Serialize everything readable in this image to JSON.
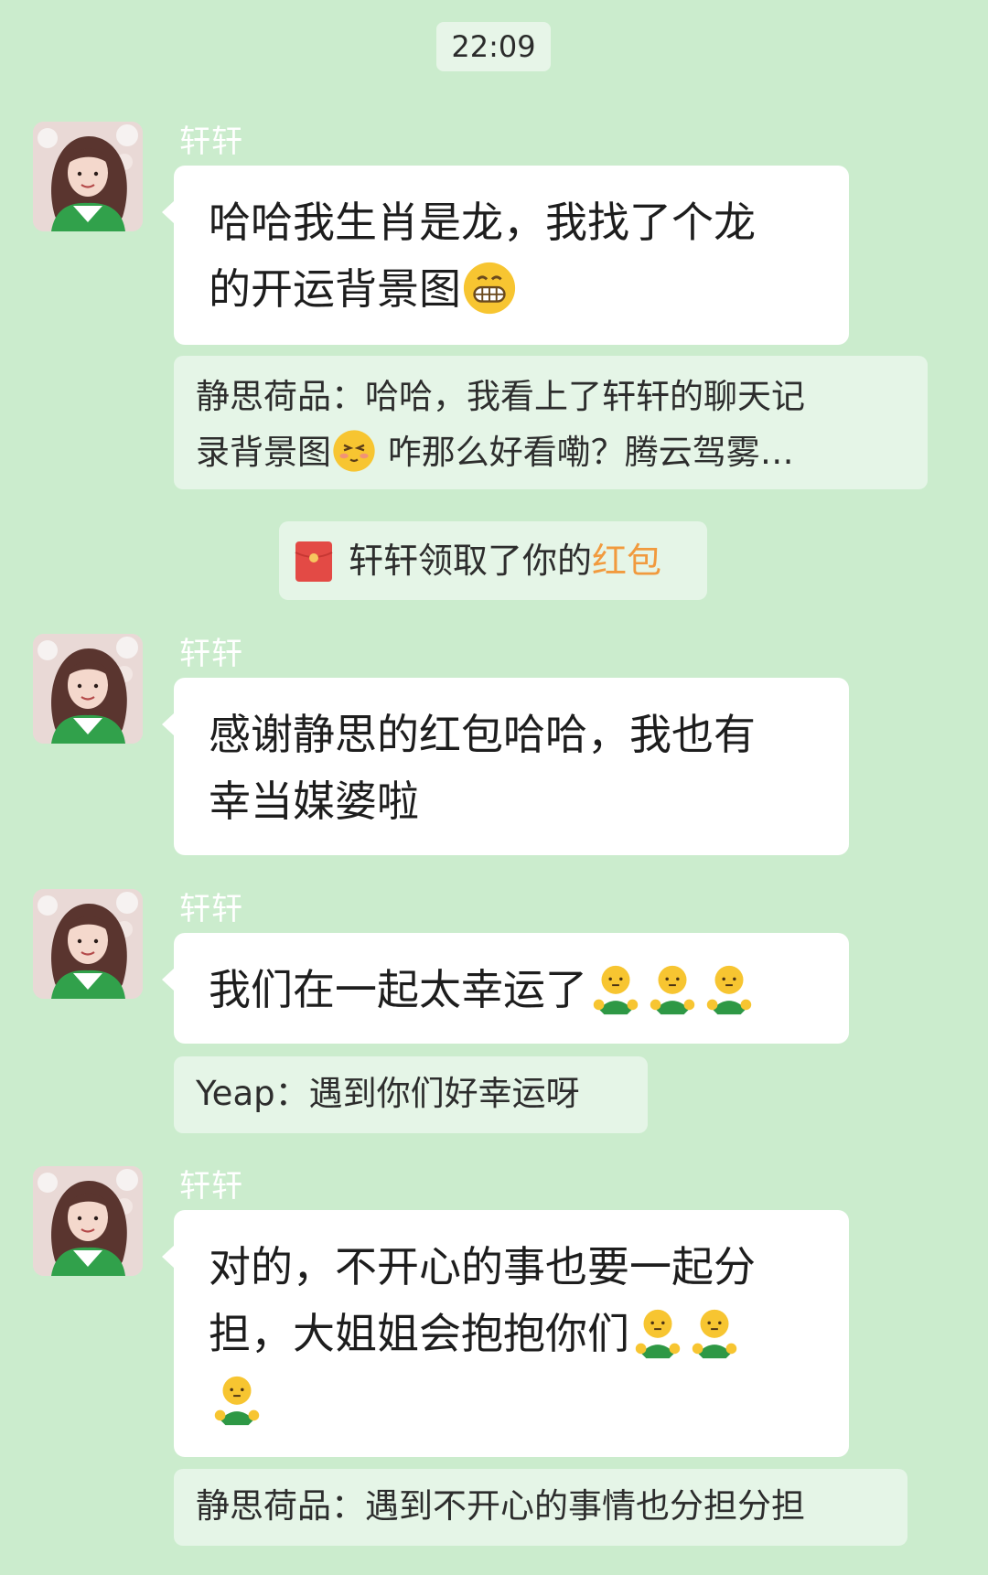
{
  "chat": {
    "timestamp": "22:09",
    "messages": [
      {
        "sender": "轩轩",
        "lines": [
          "哈哈我生肖是龙，我找了个龙",
          "的开运背景图"
        ],
        "trailing_emoji": "grin-emoji"
      },
      {
        "sender": "轩轩",
        "lines": [
          "感谢静思的红包哈哈，我也有",
          "幸当媒婆啦"
        ]
      },
      {
        "sender": "轩轩",
        "lines": [
          "我们在一起太幸运了"
        ],
        "trailing_emoji": "hug-emoji x3"
      },
      {
        "sender": "轩轩",
        "lines": [
          "对的，不开心的事也要一起分",
          "担，大姐姐会抱抱你们"
        ],
        "trailing_emoji": "hug-emoji x3"
      }
    ],
    "quotes": [
      {
        "line1": "静思荷品：哈哈，我看上了轩轩的聊天记",
        "line2_prefix": "录背景图",
        "line2_suffix": " 咋那么好看嘞？腾云驾雾…",
        "emoji": "shy-emoji"
      },
      {
        "text": "Yeap：遇到你们好幸运呀"
      },
      {
        "text": "静思荷品：遇到不开心的事情也分担分担"
      }
    ],
    "system": {
      "red_packet_text": "轩轩领取了你的",
      "red_packet_link": "红包",
      "icon": "red-packet-icon"
    }
  },
  "colors": {
    "background": "#cbeccd",
    "bubble": "#ffffff",
    "quote": "#e5f5e7",
    "link": "#f19a3e",
    "sender": "#ffffff"
  }
}
